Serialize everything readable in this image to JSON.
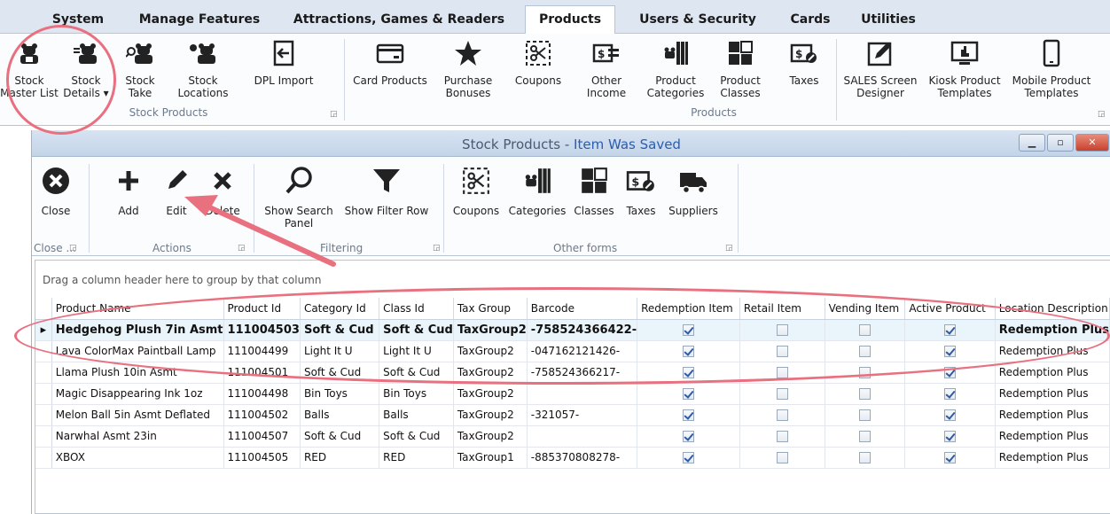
{
  "ribbon_tabs": [
    "System",
    "Manage Features",
    "Attractions, Games & Readers",
    "Products",
    "Users & Security",
    "Cards",
    "Utilities"
  ],
  "active_tab": "Products",
  "ribbon_buttons": {
    "stock_master": "Stock\nMaster List",
    "stock_details": "Stock\nDetails ▾",
    "stock_take": "Stock\nTake",
    "stock_locations": "Stock\nLocations",
    "dpl_import": "DPL Import",
    "card_products": "Card Products",
    "purchase_bonuses": "Purchase\nBonuses",
    "coupons": "Coupons",
    "other_income": "Other\nIncome",
    "product_categories": "Product\nCategories",
    "product_classes": "Product\nClasses",
    "taxes": "Taxes",
    "sales_screen": "SALES Screen\nDesigner",
    "kiosk_templates": "Kiosk Product\nTemplates",
    "mobile_templates": "Mobile Product\nTemplates"
  },
  "ribbon_groups": {
    "stock_products": "Stock Products",
    "products": "Products"
  },
  "window": {
    "title": "Stock Products - ",
    "status": "Item Was Saved"
  },
  "toolbar": {
    "close": "Close",
    "add": "Add",
    "edit": "Edit",
    "delete": "Delete",
    "show_search": "Show Search\nPanel",
    "show_filter": "Show Filter Row",
    "coupons": "Coupons",
    "categories": "Categories",
    "classes": "Classes",
    "taxes": "Taxes",
    "suppliers": "Suppliers"
  },
  "toolbar_groups": {
    "close": "Close ...",
    "actions": "Actions",
    "filtering": "Filtering",
    "other_forms": "Other forms"
  },
  "grid": {
    "group_hint": "Drag a column header here to group by that column",
    "columns": [
      "Product Name",
      "Product Id",
      "Category Id",
      "Class Id",
      "Tax Group",
      "Barcode",
      "Redemption Item",
      "Retail Item",
      "Vending Item",
      "Active Product",
      "Location Description"
    ],
    "rows": [
      {
        "name": "Hedgehog Plush 7in Asmt",
        "id": "111004503",
        "category": "Soft & Cud",
        "class": "Soft & Cud",
        "tax": "TaxGroup2",
        "barcode": "-758524366422-",
        "redemption": true,
        "retail": false,
        "vending": false,
        "active": true,
        "location": "Redemption Plus",
        "selected": true
      },
      {
        "name": "Lava ColorMax Paintball Lamp",
        "id": "111004499",
        "category": "Light It U",
        "class": "Light It U",
        "tax": "TaxGroup2",
        "barcode": "-047162121426-",
        "redemption": true,
        "retail": false,
        "vending": false,
        "active": true,
        "location": "Redemption Plus"
      },
      {
        "name": "Llama Plush 10in Asmt",
        "id": "111004501",
        "category": "Soft & Cud",
        "class": "Soft & Cud",
        "tax": "TaxGroup2",
        "barcode": "-758524366217-",
        "redemption": true,
        "retail": false,
        "vending": false,
        "active": true,
        "location": "Redemption Plus"
      },
      {
        "name": "Magic Disappearing Ink 1oz",
        "id": "111004498",
        "category": "Bin Toys",
        "class": "Bin Toys",
        "tax": "TaxGroup2",
        "barcode": "",
        "redemption": true,
        "retail": false,
        "vending": false,
        "active": true,
        "location": "Redemption Plus"
      },
      {
        "name": "Melon Ball 5in Asmt Deflated",
        "id": "111004502",
        "category": "Balls",
        "class": "Balls",
        "tax": "TaxGroup2",
        "barcode": "-321057-",
        "redemption": true,
        "retail": false,
        "vending": false,
        "active": true,
        "location": "Redemption Plus"
      },
      {
        "name": "Narwhal Asmt 23in",
        "id": "111004507",
        "category": "Soft & Cud",
        "class": "Soft & Cud",
        "tax": "TaxGroup2",
        "barcode": "",
        "redemption": true,
        "retail": false,
        "vending": false,
        "active": true,
        "location": "Redemption Plus"
      },
      {
        "name": "XBOX",
        "id": "111004505",
        "category": "RED",
        "class": "RED",
        "tax": "TaxGroup1",
        "barcode": "-885370808278-",
        "redemption": true,
        "retail": false,
        "vending": false,
        "active": true,
        "location": "Redemption Plus"
      }
    ]
  },
  "colors": {
    "annotation": "#e8707f",
    "accent": "#2a5db0"
  }
}
